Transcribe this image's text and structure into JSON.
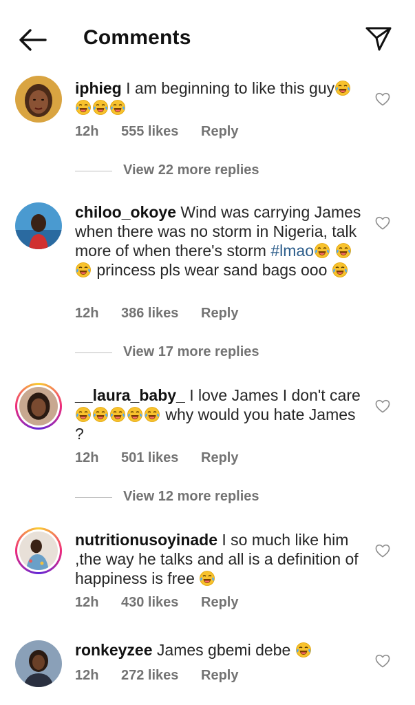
{
  "header": {
    "title": "Comments",
    "back_icon": "arrow-left-icon",
    "send_icon": "paper-plane-icon"
  },
  "comments": [
    {
      "username": "iphieg",
      "text": "I am beginning to like this guy",
      "emoji_after": 4,
      "time": "12h",
      "likes": "555 likes",
      "reply": "Reply",
      "view_more": "View 22 more replies"
    },
    {
      "username": "chiloo_okoye",
      "text": "Wind was carrying James when there was no storm in Nigeria, talk more of when there's storm",
      "hashtag": "#lmao",
      "text2": "princess pls wear sand bags ooo",
      "time": "12h",
      "likes": "386 likes",
      "reply": "Reply",
      "view_more": "View 17 more replies"
    },
    {
      "username": "__laura_baby_",
      "text": "I love James I don't care",
      "text2": "why would you hate James ?",
      "time": "12h",
      "likes": "501 likes",
      "reply": "Reply",
      "view_more": "View 12 more replies"
    },
    {
      "username": "nutritionusoyinade",
      "text": "I so much like him ,the way he talks and all is a definition of happiness is free",
      "time": "12h",
      "likes": "430 likes",
      "reply": "Reply"
    },
    {
      "username": "ronkeyzee",
      "text": "James gbemi debe",
      "time": "12h",
      "likes": "272 likes",
      "reply": "Reply"
    }
  ],
  "icons": {
    "emoji": "laughing-tears-emoji",
    "heart": "heart-outline-icon"
  },
  "colors": {
    "text": "#262626",
    "meta": "#737373",
    "hashtag": "#2b5c8a"
  }
}
